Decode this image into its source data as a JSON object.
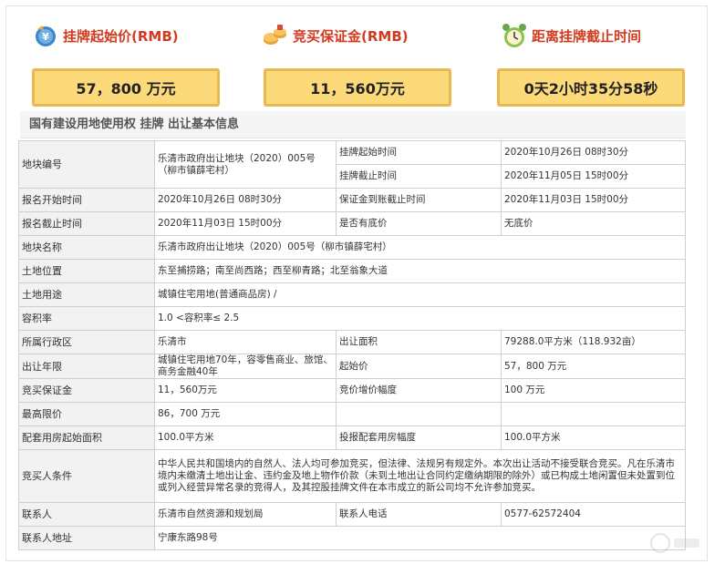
{
  "summary": {
    "start_price": {
      "title": "挂牌起始价(RMB)",
      "value": "57，800 万元",
      "icon": "money-bag-icon"
    },
    "deposit": {
      "title": "竞买保证金(RMB)",
      "value": "11，560万元",
      "icon": "coins-icon"
    },
    "countdown": {
      "title": "距离挂牌截止时间",
      "value": "0天2小时35分58秒",
      "icon": "alarm-clock-icon"
    }
  },
  "section_title": "国有建设用地使用权 挂牌 出让基本信息",
  "table": {
    "parcel_no_label": "地块编号",
    "parcel_no_value": "乐清市政府出让地块（2020）005号（柳市镇薛宅村）",
    "listing_start_label": "挂牌起始时间",
    "listing_start_value": "2020年10月26日 08时30分",
    "listing_end_label": "挂牌截止时间",
    "listing_end_value": "2020年11月05日 15时00分",
    "reg_start_label": "报名开始时间",
    "reg_start_value": "2020年10月26日 08时30分",
    "deposit_deadline_label": "保证金到账截止时间",
    "deposit_deadline_value": "2020年11月03日 15时00分",
    "reg_end_label": "报名截止时间",
    "reg_end_value": "2020年11月03日 15时00分",
    "reserve_label": "是否有底价",
    "reserve_value": "无底价",
    "parcel_name_label": "地块名称",
    "parcel_name_value": "乐清市政府出让地块（2020）005号（柳市镇薛宅村）",
    "location_label": "土地位置",
    "location_value": "东至捕捞路；南至尚西路；西至柳青路；北至翁象大道",
    "use_label": "土地用途",
    "use_value": "城镇住宅用地(普通商品房) /",
    "far_label": "容积率",
    "far_value": "1.0 <容积率≤ 2.5",
    "district_label": "所属行政区",
    "district_value": "乐清市",
    "area_label": "出让面积",
    "area_value": "79288.0平方米（118.932亩）",
    "term_label": "出让年限",
    "term_value": "城镇住宅用地70年，容零售商业、旅馆、商务金融40年",
    "start_price_label": "起始价",
    "start_price_value": "57，800 万元",
    "bid_deposit_label": "竞买保证金",
    "bid_deposit_value": "11，560万元",
    "increment_label": "竞价增价幅度",
    "increment_value": "100 万元",
    "max_price_label": "最高限价",
    "max_price_value": "86，700 万元",
    "housing_area_label": "配套用房起始面积",
    "housing_area_value": "100.0平方米",
    "housing_increment_label": "投报配套用房幅度",
    "housing_increment_value": "100.0平方米",
    "bidder_cond_label": "竞买人条件",
    "bidder_cond_value": "中华人民共和国境内的自然人、法人均可参加竞买，但法律、法规另有规定外。本次出让活动不接受联合竞买。凡在乐清市境内未缴清土地出让金、违约金及地上物作价款（未到土地出让合同约定缴纳期限的除外）或已构成土地闲置但未处置到位或列入经营异常名录的竞得人，及其控股挂牌文件在本市成立的新公司均不允许参加竞买。",
    "contact_label": "联系人",
    "contact_value": "乐清市自然资源和规划局",
    "phone_label": "联系人电话",
    "phone_value": "0577-62572404",
    "address_label": "联系人地址",
    "address_value": "宁康东路98号"
  }
}
